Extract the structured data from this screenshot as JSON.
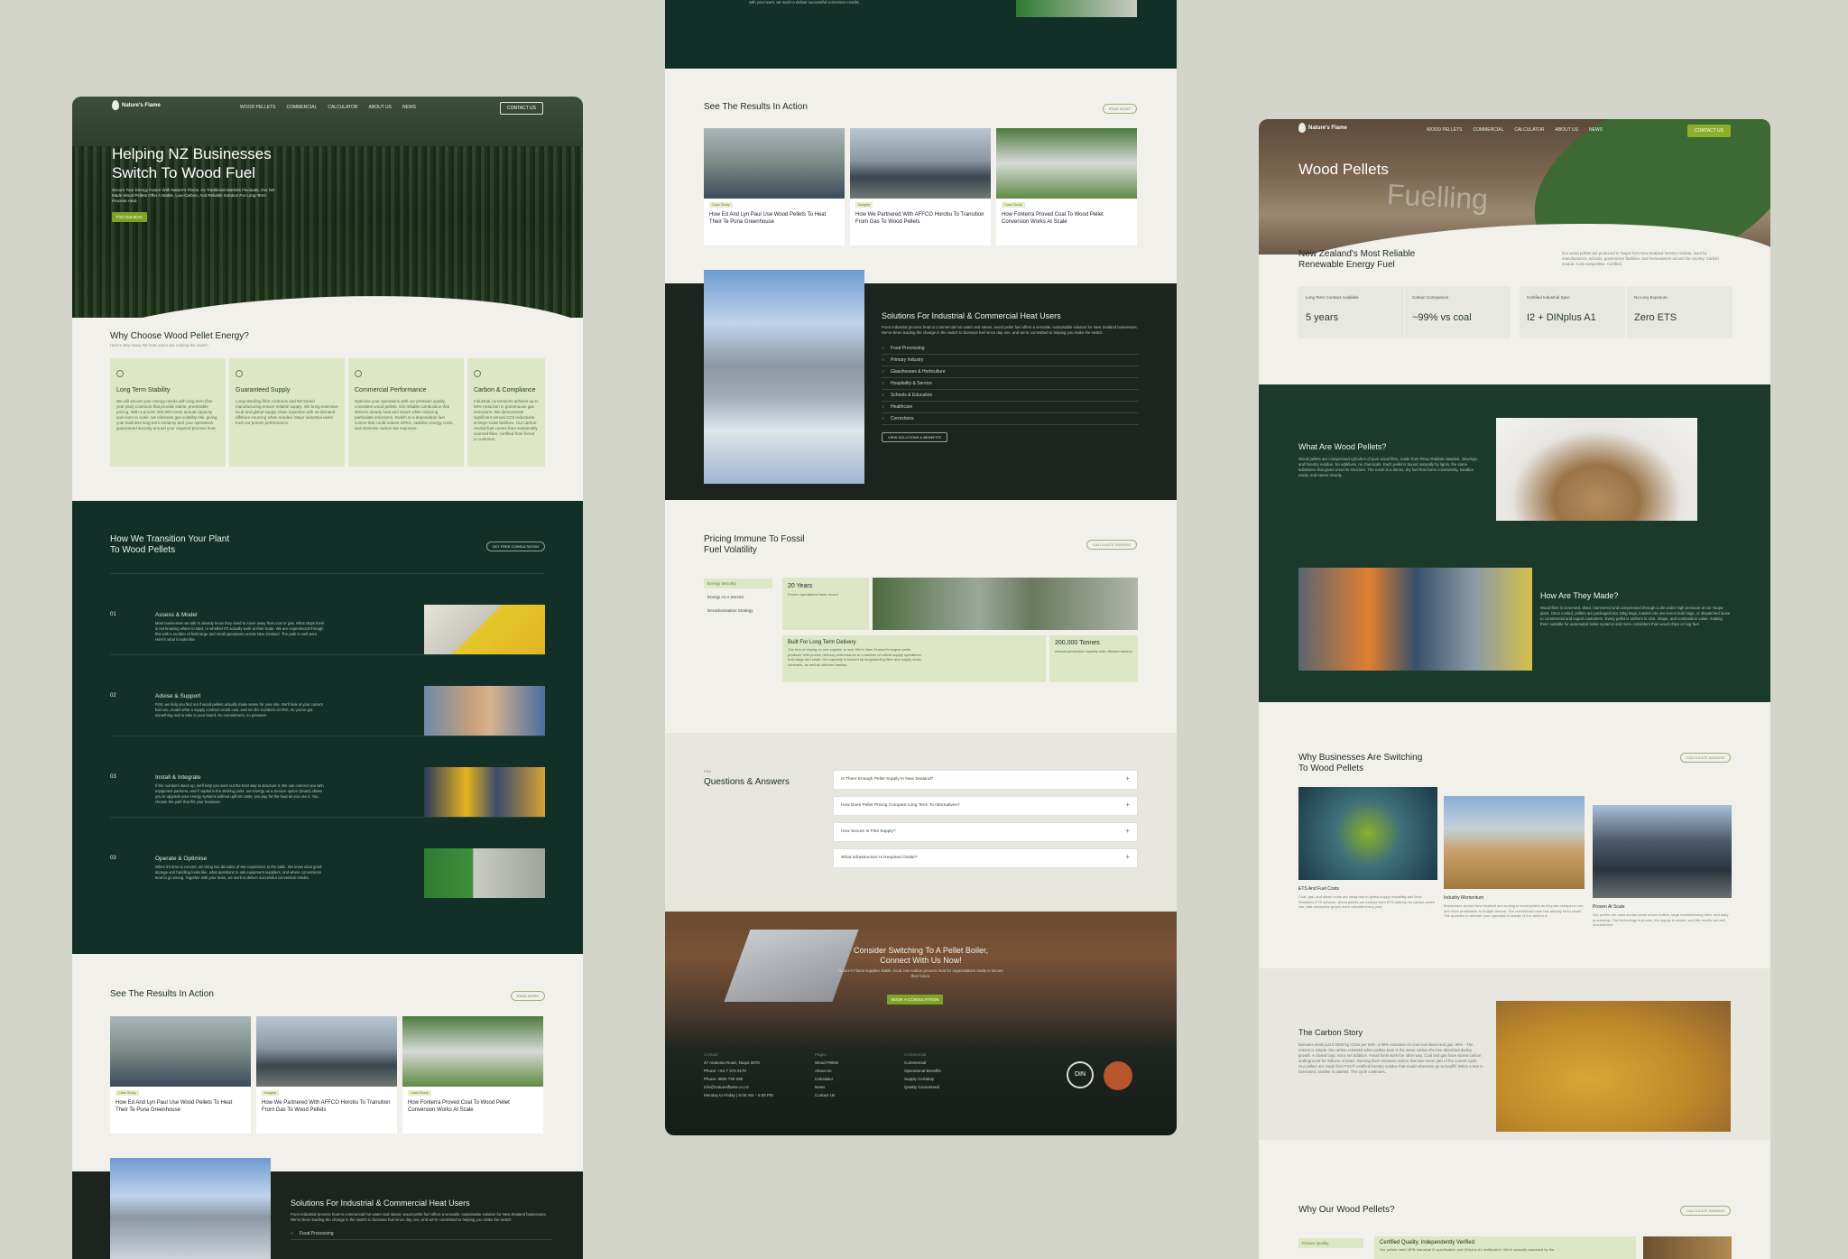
{
  "brand": {
    "name": "Nature's Flame"
  },
  "nav": {
    "links": [
      "WOOD PELLETS",
      "COMMERCIAL",
      "CALCULATOR",
      "ABOUT US",
      "NEWS"
    ],
    "contact": "CONTACT US"
  },
  "home": {
    "hero": {
      "title_l1": "Helping NZ Businesses",
      "title_l2": "Switch To Wood Fuel",
      "sub": "Secure Your Energy Future With Nature's Flame. As Traditional Markets Fluctuate, Our NZ-Made Wood Pellets Offer A Stable, Low-Carbon, And Reliable Solution For Long-Term Process Heat.",
      "cta": "Find Out More"
    },
    "why": {
      "title": "Why Choose Wood Pellet Energy?",
      "sub": "Here's why many NZ heat users are making the switch",
      "cards": [
        {
          "title": "Long Term Stability",
          "body": "We will secure your energy needs with long term (five year plus) contracts that provide stable, predictable pricing. With a proven 200,000 tonne annual capacity and room to scale, we eliminate gas volatility risk, giving your business long-term certainty and your operations guaranteed security around your required process heat."
        },
        {
          "title": "Guaranteed Supply",
          "body": "Long-standing fibre contracts and NZ-based manufacturing ensure reliable supply. We bring extensive local and global supply chain expertise with on-demand offshore sourcing when needed. Major industrial users trust our proven performance."
        },
        {
          "title": "Commercial Performance",
          "body": "Optimise your operations with our premium quality, consistent wood pellets. Get reliable combustion that delivers steady heat and steam while reducing particulate emissions. Switch to a dependable fuel source that could reduce OPEX, stabilise energy costs, and minimise carbon tax exposure."
        },
        {
          "title": "Carbon & Compliance",
          "body": "Industrial conversions achieve up to 99% reduction in greenhouse gas emissions. We demonstrate significant annual CO2 reductions at large-scale facilities. Our carbon-neutral fuel comes from sustainably sourced fibre, certified from forest to customer."
        }
      ]
    },
    "transition": {
      "title_l1": "How We Transition Your Plant",
      "title_l2": "To Wood Pellets",
      "cta": "GET FREE CONSULTATION",
      "steps": [
        {
          "n": "01",
          "title": "Assess & Model",
          "body": "Most businesses we talk to already know they need to move away from coal or gas. What stops them is not knowing where to start, or whether it'll actually work at their scale. We are experienced through this with a number of both large and small operations across New Zealand. The path is well worn. Here's what it looks like."
        },
        {
          "n": "02",
          "title": "Advise & Support",
          "body": "First, we help you find out if wood pellets actually make sense for your site. We'll look at your current fuel use, model what a supply contract would cost, and run the numbers on ROI, so you've got something real to take to your board. No commitment, no pressure."
        },
        {
          "n": "03",
          "title": "Install & Integrate",
          "body": "If the numbers stack up, we'll help you work out the best way to structure it. We can connect you with equipment partners, and if capital is the sticking point, our Energy as a Service option (EaaS) allows you to upgrade your energy systems without upfront costs, you pay for the heat as you use it. You choose the path that fits your business."
        },
        {
          "n": "03",
          "title": "Operate & Optimise",
          "body": "When it's time to convert, we bring two decades of site experience to the table. We know what good storage and handling looks like, what questions to ask equipment suppliers, and where conversions tend to go wrong. Together with your team, we work to deliver successful conversion results."
        }
      ]
    },
    "results": {
      "title": "See The Results In Action",
      "cta": "READ MORE",
      "cards": [
        {
          "tag": "Case Study",
          "title": "How Ed And Lyn Paul Use Wood Pellets To Heat Their Te Puna Greenhouse"
        },
        {
          "tag": "Insights",
          "title": "How We Partnered With AFFCO Horotiu To Transition From Gas To Wood Pellets"
        },
        {
          "tag": "Case Study",
          "title": "How Fonterra Proved Coal To Wood Pellet Conversion Works At Scale"
        }
      ]
    },
    "solutions": {
      "title": "Solutions For Industrial & Commercial Heat Users",
      "body": "From industrial process heat to commercial hot water and steam, wood pellet fuel offers a versatile, sustainable solution for New Zealand businesses. We've been leading the change in the switch to biomass fuel since day one, and we're committed to helping you make the switch.",
      "first": "Food Processing"
    }
  },
  "commercial": {
    "top_text": "with your team, we work to deliver successful conversion results.",
    "results": {
      "title": "See The Results In Action",
      "cta": "READ MORE"
    },
    "solutions": {
      "title": "Solutions For Industrial & Commercial Heat Users",
      "body": "From industrial process heat to commercial hot water and steam, wood pellet fuel offers a versatile, sustainable solution for New Zealand businesses. We've been leading the change in the switch to biomass fuel since day one, and we're committed to helping you make the switch.",
      "items": [
        "Food Processing",
        "Primary Industry",
        "Glasshouses & Horticulture",
        "Hospitality & Service",
        "Schools & Education",
        "Healthcare",
        "Corrections"
      ],
      "cta": "VIEW SOLUTIONS & BENEFITS"
    },
    "pricing": {
      "title_l1": "Pricing Immune To Fossil",
      "title_l2": "Fuel Volatility",
      "cta": "CALCULATE SAVINGS",
      "tabs": [
        "Energy Security",
        "Energy As A Service",
        "Decarbonisation Strategy"
      ],
      "s1": {
        "v": "20 Years",
        "d": "Proven operational track record"
      },
      "s2": {
        "v": "Built For Long Term Delivery",
        "d": "The fear of relying on one supplier is real. We're New Zealand's largest pellet producer with proven delivery performance to a number of critical supply operations both large and small. Our capacity is backed by longstanding fibre and supply chain contracts, as well as offshore backup."
      },
      "s3": {
        "v": "200,000 Tonnes",
        "d": "Annual production capacity with offshore backup"
      }
    },
    "faq": {
      "eyebrow": "FAQ",
      "title": "Questions & Answers",
      "items": [
        "Is There Enough Pellet Supply In New Zealand?",
        "How Does Pellet Pricing Compare Long Term To Alternatives?",
        "How Secure Is Pilot Supply?",
        "What Infrastructure Is Required Onsite?"
      ]
    },
    "cta": {
      "l1": "Consider Switching To A Pellet Boiler,",
      "l2": "Connect With Us Now!",
      "sub": "Nature's Flame supplies stable, local, low-carbon process heat for organisations ready to secure their future.",
      "btn": "BOOK A CONSULTATION"
    },
    "footer": {
      "contact_h": "Contact",
      "contact": [
        "27 Anatonia Road, Taupō 3378",
        "Phone: +64 7 376 0170",
        "Phone: 0800 730 538",
        "info@naturesflame.co.nz",
        "Monday to Friday  |  8:00 AM – 5:00 PM"
      ],
      "prod_h": "Pages",
      "prod": [
        "Wood Pellets",
        "About Us",
        "Calculator",
        "News",
        "Contact Us"
      ],
      "com_h": "Commercial",
      "com": [
        "Commercial",
        "Operational Benefits",
        "Supply Certainty",
        "Quality Guaranteed"
      ],
      "badge": "DIN"
    }
  },
  "pellets": {
    "hero": {
      "title": "Wood Pellets",
      "word": "Fuelling"
    },
    "intro": {
      "title_l1": "New Zealand's Most Reliable",
      "title_l2": "Renewable Energy Fuel",
      "body": "Our wood pellets are produced in Taupō from New Zealand forestry residue, used by manufacturers, schools, government facilities, and homeowners across the country. Carbon neutral. Cost-competitive. Certified."
    },
    "stats": [
      {
        "l": "Long Term Contract Available",
        "v": "5 years"
      },
      {
        "l": "Carbon Comparison",
        "v": "~99% vs coal"
      },
      {
        "l": "Certified Industrial Spec",
        "v": "I2 + DINplus A1"
      },
      {
        "l": "No Levy Exposure",
        "v": "Zero ETS"
      }
    ],
    "what": {
      "title": "What Are Wood Pellets?",
      "body": "Wood pellets are compressed cylinders of pure wood fibre, made from Pinus Radiata sawdust, shavings, and forestry residue. No additives, no chemicals. Each pellet is bound naturally by lignin, the same substance that gives wood its structure. The result is a dense, dry fuel that burns consistently, handles easily, and stores cleanly."
    },
    "how": {
      "title": "How Are They Made?",
      "body": "Wood fibre is screened, dried, hammered and compressed through a die under high pressure at our Taupō plant. Once cooled, pellets are packaged into 15kg bags, loaded into one-tonne bulk bags, or dispatched loose to commercial and export customers. Every pellet is uniform in size, shape, and combustion value, making them suitable for automated boiler systems and more consistent than wood chips or hog fuel."
    },
    "switch": {
      "title_l1": "Why Businesses Are Switching",
      "title_l2": "To Wood Pellets",
      "cta": "CALCULATE SAVINGS",
      "items": [
        {
          "t": "ETS And Fuel Costs",
          "d": "Coal, gas, and diesel costs are rising due to global supply instability and New Zealand's ETS scheme. Wood pellets are exempt from ETS entirely. As carbon prices rise, that exemption grows more valuable every year."
        },
        {
          "t": "Industry Momentum",
          "d": "Businesses across New Zealand are moving to wood pellets as they are cheaper to run and more predictable to budget around. The commercial case has already been made. The question is whether your operation is ahead of it or behind it."
        },
        {
          "t": "Proven At Scale",
          "d": "Our pellets are used across small school boilers, large manufacturing sites, and dairy processing. The technology is proven, the supply is secure, and the results are well documented."
        }
      ]
    },
    "carbon": {
      "title": "The Carbon Story",
      "body": "Biomass emits just 0.0009 kg CO2e per kWh, a 99% reduction on coal and diesel and gas. 99% - The reason is simple: the carbon released when pellets burn is the same carbon the tree absorbed during growth. A closed loop, not a net addition. Fossil fuels work the other way. Coal and gas have stored carbon underground for millions of years. Burning them releases carbon that was never part of the current cycle. Our pellets are made from FSC® certified forestry residue that would otherwise go to landfill. When a tree is harvested, another is planted. The cycle continues."
    },
    "why": {
      "title": "Why Our Wood Pellets?",
      "cta": "CALCULATE SAVINGS",
      "tab1": "Proven Quality",
      "card": "Certified Quality, Independently Verified",
      "cardsub": "Our pellets meet ISPB Industrial I2 specification and DINplus A1 certification. We're annually assessed by the"
    }
  }
}
